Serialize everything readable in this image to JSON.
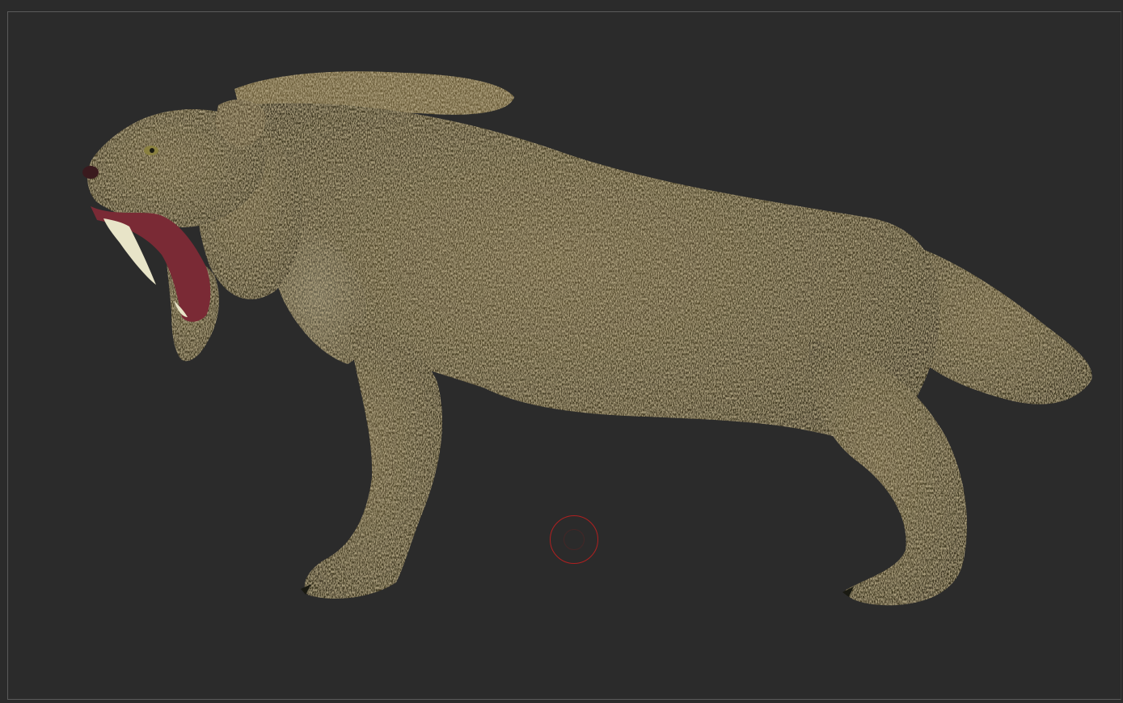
{
  "viewport": {
    "background_color": "#2b2b2b",
    "frame_color": "#5a5a5a"
  },
  "model": {
    "subject": "saber-tooth cat",
    "fur_dark": "#3a3420",
    "fur_mid": "#5e5232",
    "fur_light": "#9a8552",
    "tooth_color": "#e8e4c8",
    "mouth_color": "#7a2a35"
  },
  "cursor": {
    "icon": "brush-ring-icon",
    "color": "#b02020"
  }
}
